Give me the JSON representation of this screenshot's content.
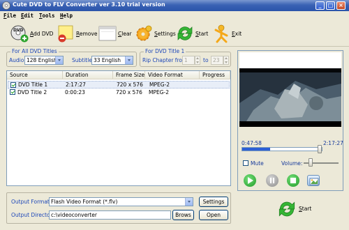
{
  "window": {
    "title": "Cute DVD to FLV Converter ver 3.10  trial version"
  },
  "menu": [
    {
      "hot": "F",
      "rest": "ile"
    },
    {
      "hot": "E",
      "rest": "dit"
    },
    {
      "hot": "T",
      "rest": "ools"
    },
    {
      "hot": "H",
      "rest": "elp"
    }
  ],
  "toolbar": {
    "add_dvd": {
      "hot": "A",
      "rest": "dd DVD"
    },
    "remove": {
      "hot": "R",
      "rest": "emove"
    },
    "clear": {
      "hot": "C",
      "rest": "lear"
    },
    "settings": {
      "hot": "S",
      "rest": "ettings"
    },
    "start": {
      "hot": "S",
      "rest": "tart"
    },
    "exit": {
      "hot": "E",
      "rest": "xit"
    }
  },
  "all_titles": {
    "legend": "For All DVD Titles",
    "audio_label": "Audio:",
    "audio_value": "128  English",
    "subtitle_label": "Subtitle:",
    "subtitle_value": "33  English"
  },
  "title1": {
    "legend": "For DVD Title 1",
    "rip_label": "Rip Chapter from:",
    "from_value": "1",
    "to_label": "to",
    "to_value": "23"
  },
  "list": {
    "columns": [
      "Source",
      "Duration",
      "Frame Size",
      "Video Format",
      "Progress"
    ],
    "rows": [
      {
        "source": "DVD Title 1",
        "duration": "2:17:27",
        "frame": "720 x 576",
        "format": "MPEG-2",
        "progress": ""
      },
      {
        "source": "DVD Title 2",
        "duration": "0:00:23",
        "frame": "720 x 576",
        "format": "MPEG-2",
        "progress": ""
      }
    ]
  },
  "player": {
    "current_time": "0:47:58",
    "total_time": "2:17:27",
    "progress_fraction": 0.35,
    "mute_label": "Mute",
    "volume_label": "Volume:",
    "volume_fraction": 0.15
  },
  "output": {
    "format_label": "Output Format:",
    "format_value": "Flash Video Format (*.flv)",
    "dir_label": "Output Directory:",
    "dir_value": "c:\\videoconverter",
    "settings_button": "Settings",
    "browse_button": "Brows",
    "open_button": "Open"
  },
  "start_big": {
    "hot": "S",
    "rest": "tart"
  },
  "colors": {
    "title_bar": "#2a54aa",
    "accent_label": "#1c46b9",
    "seek_fill": "#2c5fd6"
  }
}
